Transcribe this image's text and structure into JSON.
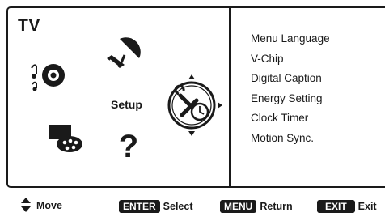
{
  "header": {
    "title": "TV"
  },
  "category_wheel": {
    "selected_label": "Setup",
    "icons": [
      "speaker-icon",
      "satellite-dish-icon",
      "palette-icon",
      "help-icon",
      "setup-tools-icon"
    ]
  },
  "menu": {
    "items": [
      {
        "label": "Menu Language"
      },
      {
        "label": "V-Chip"
      },
      {
        "label": "Digital Caption"
      },
      {
        "label": "Energy Setting"
      },
      {
        "label": "Clock Timer"
      },
      {
        "label": "Motion Sync."
      }
    ]
  },
  "footer": {
    "move_label": "Move",
    "enter_key": "ENTER",
    "enter_label": "Select",
    "menu_key": "MENU",
    "menu_label": "Return",
    "exit_key": "EXIT",
    "exit_label": "Exit"
  },
  "colors": {
    "ink": "#1a1a1a",
    "background": "#ffffff"
  }
}
